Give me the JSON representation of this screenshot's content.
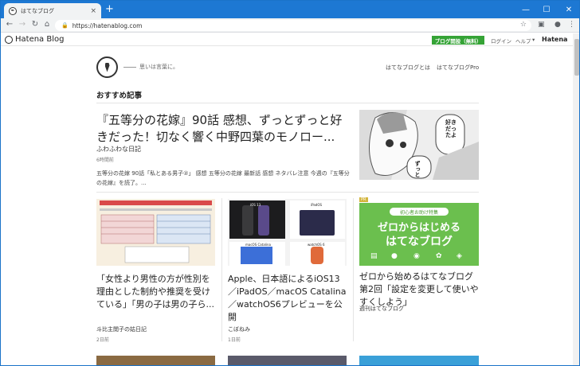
{
  "browser": {
    "tab_title": "はてなブログ",
    "tab_close": "×",
    "new_tab": "+",
    "url": "https://hatenablog.com",
    "min": "—",
    "max": "☐",
    "close": "✕"
  },
  "hatena_bar": {
    "logo": "Hatena Blog",
    "open_blog": "ブログ開設（無料）",
    "login": "ログイン",
    "help": "ヘルプ",
    "brand": "Hatena"
  },
  "site": {
    "tagline": "思いは言葉に。",
    "link_about": "はてなブログとは",
    "link_pro": "はてなブログPro"
  },
  "section_title": "おすすめ記事",
  "featured": {
    "title": "『五等分の花嫁』90話 感想、ずっとずっと好きだった！切なく響く中野四葉のモノロー...",
    "blog": "ふわふわな日記",
    "time": "6時間前",
    "desc": "五等分の花嫁 90話「私とある男子②」 感想 五等分の花嫁 最新話 感想 ネタバレ注意 今週の『五等分の花嫁』を読了。...",
    "img_text_1": "好きだったよ",
    "img_text_2": "ずっと"
  },
  "cards": [
    {
      "title": "「女性より男性の方が性別を理由とした制約や推奨を受けている」「男の子は男の子ら...",
      "blog": "斗比主閲子の姑日記",
      "time": "2日前"
    },
    {
      "title": "Apple、日本語によるiOS13／iPadOS／macOS Catalina／watchOS6プレビューを公開",
      "blog": "こぼねみ",
      "time": "1日前",
      "img_label_1": "iOS 13",
      "img_label_2": "iPadOS",
      "img_label_3": "macOS Catalina",
      "img_label_4": "watchOS 6"
    },
    {
      "title": "ゼロから始めるはてなブログ 第2回「設定を変更して使いやすくしよう」",
      "blog": "週刊はてなブログ",
      "time": "",
      "ad_label": "PR",
      "img_badge": "初心者お助け特集",
      "img_title_1": "ゼロからはじめる",
      "img_title_2": "はてなブログ"
    }
  ],
  "colors": {
    "chrome_blue": "#1d78d3",
    "green_button": "#35a336",
    "card3_bg": "#6bbf4e"
  }
}
